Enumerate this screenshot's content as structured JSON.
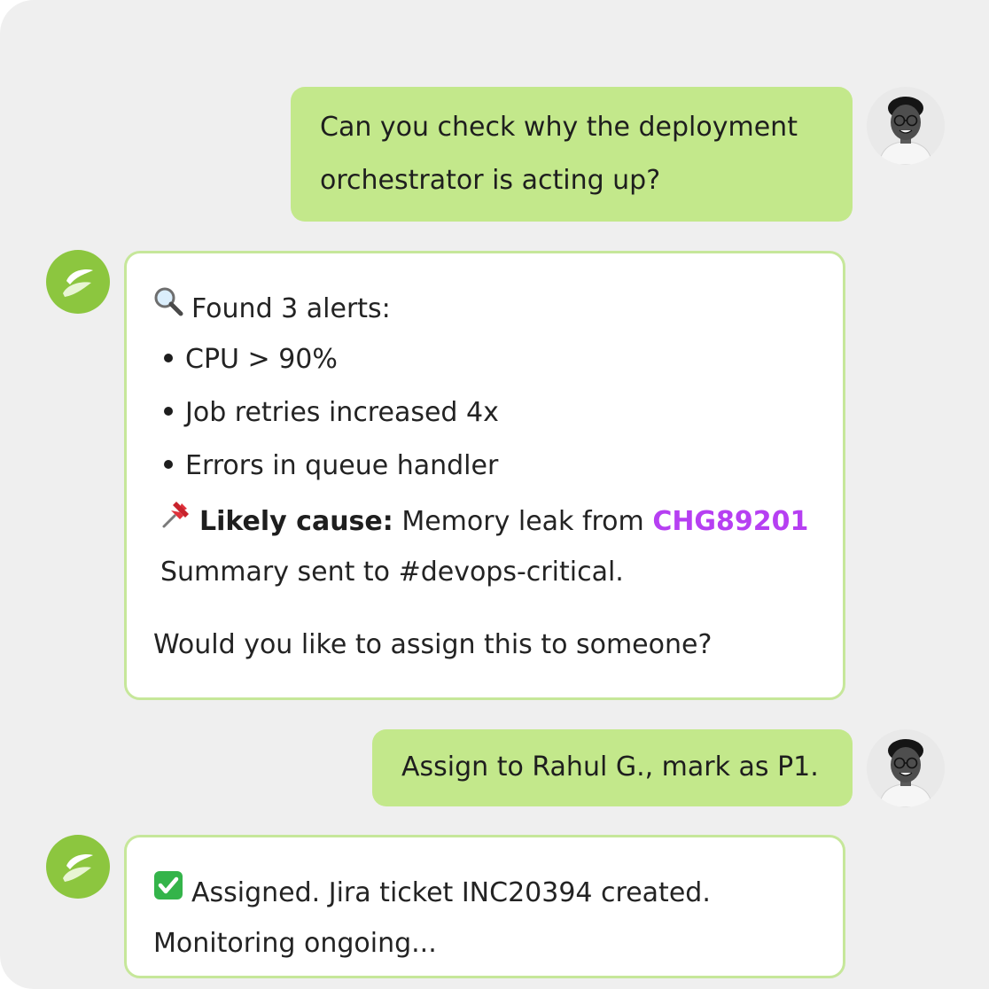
{
  "colors": {
    "accent": "#b63ff2",
    "bubble_user": "#c3e88b",
    "bot_border": "#c6e79a",
    "bot_avatar": "#8cc63f",
    "background": "#efefef"
  },
  "icons": {
    "user_avatar": "person-photo-avatar",
    "bot_avatar": "leaf-logo-avatar",
    "search": "magnifying-glass-icon",
    "pin": "pushpin-icon",
    "check": "green-checkmark-icon"
  },
  "messages": [
    {
      "role": "user",
      "lines": [
        "Can you check why the deployment",
        "orchestrator is acting up?"
      ]
    },
    {
      "role": "bot",
      "header": "Found 3 alerts:",
      "bullets": [
        "CPU > 90%",
        "Job retries increased 4x",
        "Errors in queue handler"
      ],
      "cause_label": "Likely cause:",
      "cause_text": "Memory leak from",
      "cause_ref": "CHG89201",
      "summary": "Summary sent to #devops-critical.",
      "question": "Would you like to assign this to someone?"
    },
    {
      "role": "user",
      "lines": [
        "Assign to Rahul G., mark as P1."
      ]
    },
    {
      "role": "bot",
      "line1": "Assigned. Jira ticket INC20394 created.",
      "line2": "Monitoring ongoing..."
    }
  ]
}
